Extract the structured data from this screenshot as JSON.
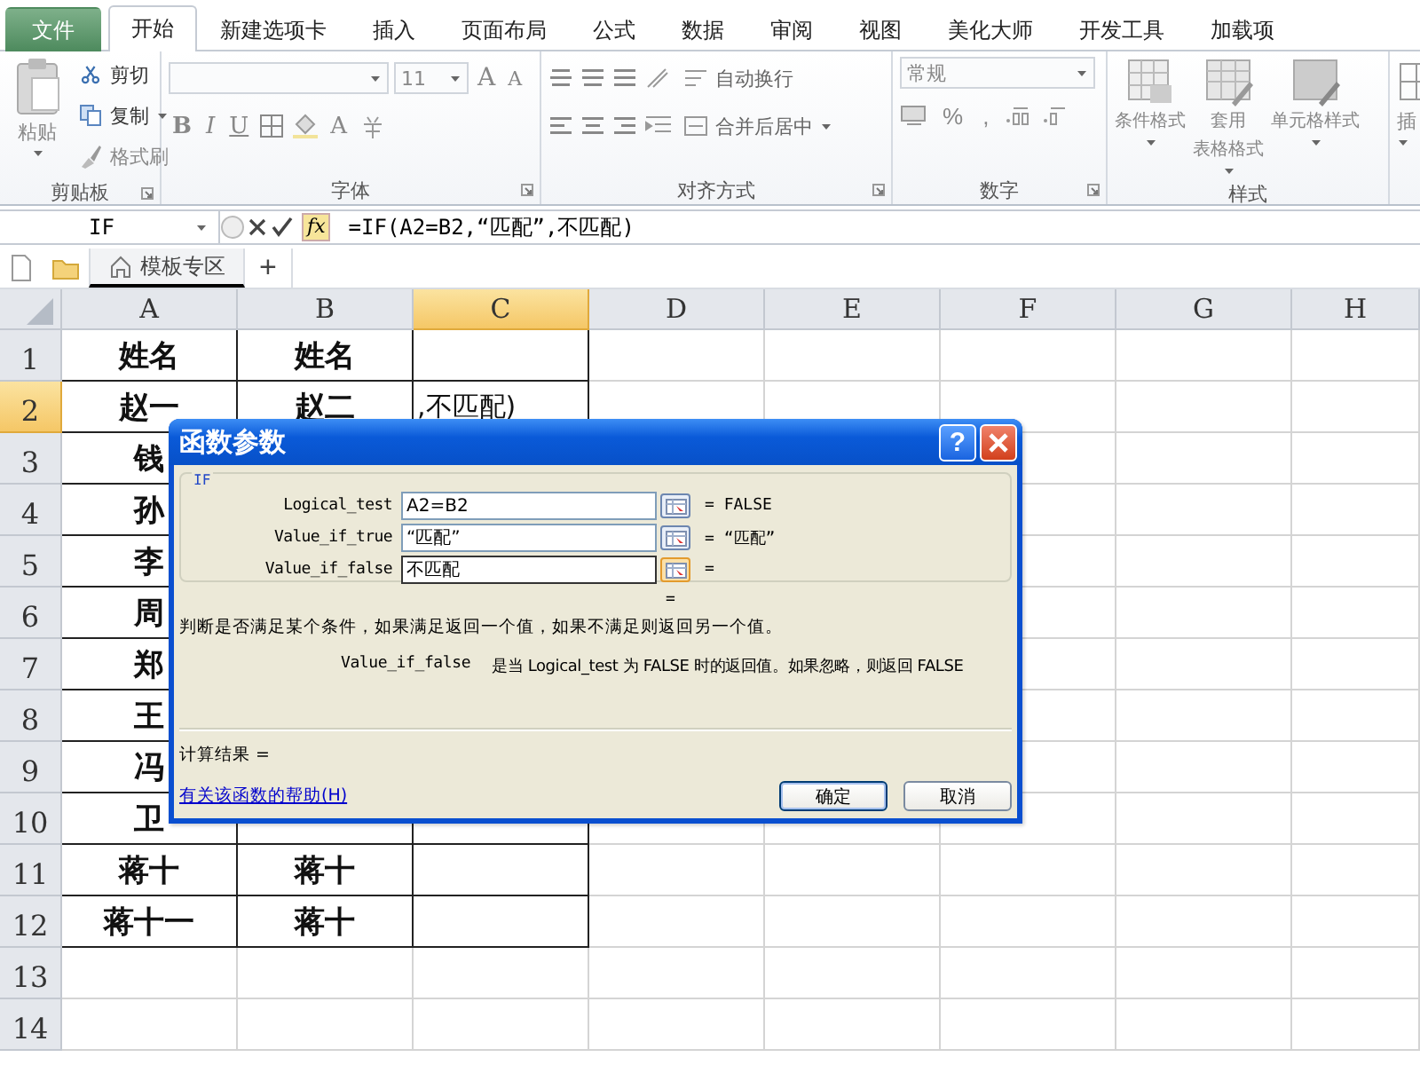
{
  "menu_tabs": [
    {
      "label": "文件",
      "kind": "file",
      "selected": false
    },
    {
      "label": "开始",
      "kind": "tab",
      "selected": true
    },
    {
      "label": "新建选项卡",
      "kind": "tab",
      "selected": false
    },
    {
      "label": "插入",
      "kind": "tab",
      "selected": false
    },
    {
      "label": "页面布局",
      "kind": "tab",
      "selected": false
    },
    {
      "label": "公式",
      "kind": "tab",
      "selected": false
    },
    {
      "label": "数据",
      "kind": "tab",
      "selected": false
    },
    {
      "label": "审阅",
      "kind": "tab",
      "selected": false
    },
    {
      "label": "视图",
      "kind": "tab",
      "selected": false
    },
    {
      "label": "美化大师",
      "kind": "tab",
      "selected": false
    },
    {
      "label": "开发工具",
      "kind": "tab",
      "selected": false
    },
    {
      "label": "加载项",
      "kind": "tab",
      "selected": false
    }
  ],
  "ribbon": {
    "groups": [
      {
        "kind": "clipboard",
        "label": "剪贴板",
        "paste": "粘贴",
        "items": [
          "剪切",
          "复制",
          "格式刷"
        ]
      },
      {
        "kind": "font",
        "label": "字体",
        "font_size": "11",
        "size_letters": [
          "A",
          "A"
        ],
        "style_letters": [
          "B",
          "I",
          "U"
        ],
        "color_letter": "A"
      },
      {
        "kind": "alignment",
        "label": "对齐方式",
        "items": [
          "自动换行",
          "合并后居中"
        ]
      },
      {
        "kind": "number",
        "label": "数字",
        "format": "常规",
        "symbols": [
          "%",
          ","
        ]
      },
      {
        "kind": "styles",
        "label": "样式",
        "items": [
          [
            "条件格式"
          ],
          [
            "套用",
            "表格格式"
          ],
          [
            "单元格样式"
          ]
        ]
      },
      {
        "kind": "cells",
        "items": [
          "插"
        ]
      }
    ]
  },
  "formula_bar": {
    "name_box": "IF",
    "fx": "fx",
    "formula": "=IF(A2=B2,“匹配”,不匹配)"
  },
  "sheet_tabs": {
    "tabs": [
      "模板专区"
    ],
    "add": "+"
  },
  "sheet": {
    "columns": [
      {
        "label": "A",
        "selected": false
      },
      {
        "label": "B",
        "selected": false
      },
      {
        "label": "C",
        "selected": true
      },
      {
        "label": "D",
        "selected": false
      },
      {
        "label": "E",
        "selected": false
      },
      {
        "label": "F",
        "selected": false
      },
      {
        "label": "G",
        "selected": false
      },
      {
        "label": "H",
        "selected": false
      }
    ],
    "rows": [
      {
        "label": "1",
        "selected": false,
        "cells": [
          "姓名",
          "姓名"
        ]
      },
      {
        "label": "2",
        "selected": true,
        "cells": [
          "赵一",
          "赵二",
          ",不匹配)"
        ]
      },
      {
        "label": "3",
        "selected": false,
        "cells": [
          "钱"
        ]
      },
      {
        "label": "4",
        "selected": false,
        "cells": [
          "孙"
        ]
      },
      {
        "label": "5",
        "selected": false,
        "cells": [
          "李"
        ]
      },
      {
        "label": "6",
        "selected": false,
        "cells": [
          "周"
        ]
      },
      {
        "label": "7",
        "selected": false,
        "cells": [
          "郑"
        ]
      },
      {
        "label": "8",
        "selected": false,
        "cells": [
          "王"
        ]
      },
      {
        "label": "9",
        "selected": false,
        "cells": [
          "冯"
        ]
      },
      {
        "label": "10",
        "selected": false,
        "cells": [
          "卫"
        ]
      },
      {
        "label": "11",
        "selected": false,
        "cells": [
          "蒋十",
          "蒋十"
        ]
      },
      {
        "label": "12",
        "selected": false,
        "cells": [
          "蒋十一",
          "蒋十"
        ]
      },
      {
        "label": "13",
        "selected": false
      },
      {
        "label": "14",
        "selected": false
      }
    ]
  },
  "dialog": {
    "title": "函数参数",
    "help": "?",
    "function": "IF",
    "args": [
      {
        "label": "Logical_test",
        "value": "A2=B2",
        "result": "= FALSE",
        "focused": false
      },
      {
        "label": "Value_if_true",
        "value": "“匹配”",
        "result": "= “匹配”",
        "focused": false
      },
      {
        "label": "Value_if_false",
        "value": "不匹配",
        "result": "=",
        "focused": true
      }
    ],
    "total": "=",
    "description": "判断是否满足某个条件，如果满足返回一个值，如果不满足则返回另一个值。",
    "param_name": "Value_if_false",
    "param_description": "是当 Logical_test 为 FALSE 时的返回值。如果忽略，则返回 FALSE",
    "result_label": "计算结果 =",
    "help_link": "有关该函数的帮助(H)",
    "buttons": [
      {
        "label": "确定",
        "default": true
      },
      {
        "label": "取消",
        "default": false
      }
    ]
  }
}
